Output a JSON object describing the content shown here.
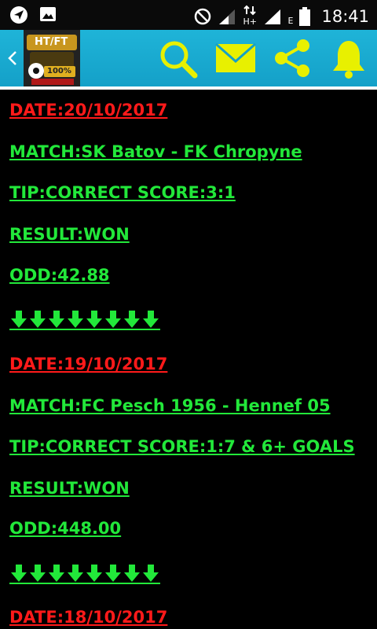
{
  "status_bar": {
    "time": "18:41",
    "network_label": "H+",
    "sim_label": "E",
    "icons": [
      "send-icon",
      "image-icon",
      "do-not-disturb-icon",
      "signal-icon",
      "data-arrows-icon",
      "signal-icon",
      "battery-icon"
    ]
  },
  "app_bar": {
    "back_icon": "chevron-left-icon",
    "logo_text": "HT/FT",
    "logo_badge": "100%",
    "actions": [
      "search-icon",
      "mail-icon",
      "share-icon",
      "bell-icon"
    ]
  },
  "colors": {
    "accent": "#1fb4d8",
    "date": "#ff1a1a",
    "text": "#22e83a",
    "icon": "#e8f000"
  },
  "tips": [
    {
      "date": "DATE:20/10/2017",
      "match": "MATCH:SK Batov - FK Chropyne",
      "tip": "TIP:CORRECT SCORE:3:1",
      "result": "RESULT:WON",
      "odd": "ODD:42.88"
    },
    {
      "date": "DATE:19/10/2017",
      "match": "MATCH:FC Pesch 1956 - Hennef 05",
      "tip": "TIP:CORRECT SCORE:1:7 & 6+ GOALS",
      "result": "RESULT:WON",
      "odd": "ODD:448.00"
    },
    {
      "date": "DATE:18/10/2017"
    }
  ]
}
